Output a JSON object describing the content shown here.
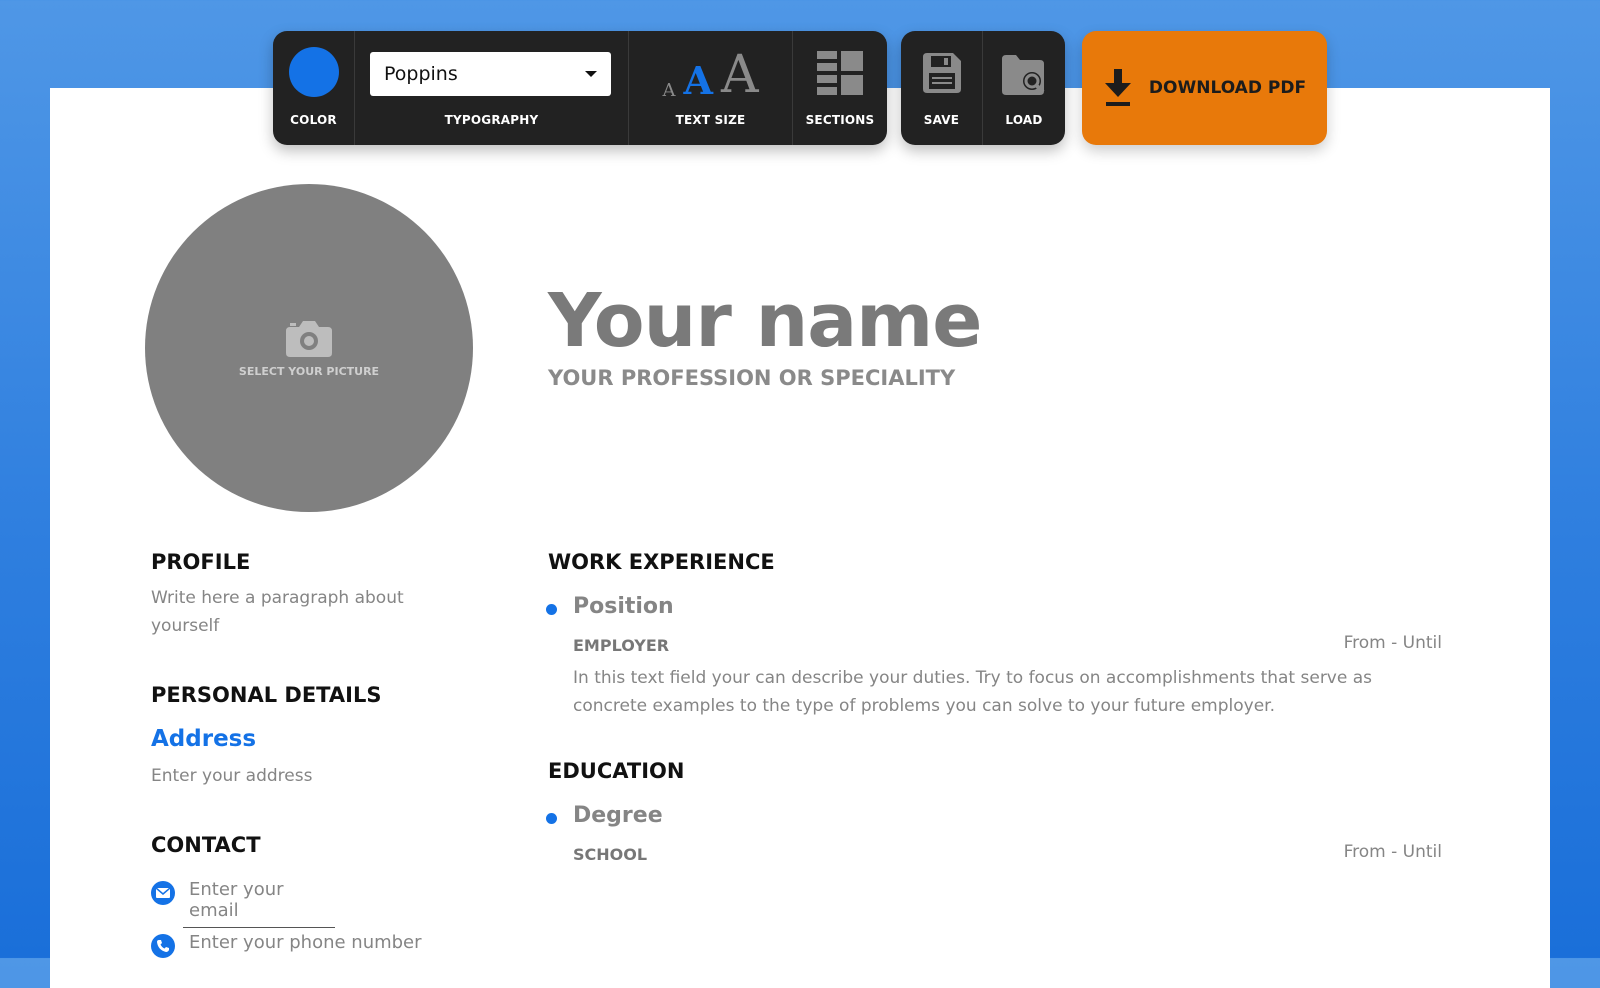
{
  "toolbar": {
    "color_label": "COLOR",
    "typography_label": "TYPOGRAPHY",
    "font_value": "Poppins",
    "text_size_label": "TEXT SIZE",
    "sections_label": "SECTIONS",
    "save_label": "SAVE",
    "load_label": "LOAD",
    "download_label": "DOWNLOAD PDF",
    "accent_color": "#1472e6",
    "download_color": "#e8790a"
  },
  "resume": {
    "photo_label": "SELECT YOUR PICTURE",
    "name": "Your name",
    "profession": "YOUR PROFESSION OR SPECIALITY",
    "profile_heading": "PROFILE",
    "profile_text_1": "Write here a paragraph about",
    "profile_text_2": "yourself",
    "personal_heading": "PERSONAL DETAILS",
    "address_title": "Address",
    "address_placeholder": "Enter your address",
    "contact_heading": "CONTACT",
    "email_placeholder": "Enter your email",
    "phone_placeholder": "Enter your phone number",
    "work_heading": "WORK EXPERIENCE",
    "work": {
      "position": "Position",
      "employer": "EMPLOYER",
      "dates": "From - Until",
      "description_1": "In this text field your can describe your duties. Try to focus on accomplishments that serve as",
      "description_2": "concrete examples to the type of problems you can solve to your future employer."
    },
    "education_heading": "EDUCATION",
    "education": {
      "degree": "Degree",
      "school": "SCHOOL",
      "dates": "From - Until"
    }
  }
}
